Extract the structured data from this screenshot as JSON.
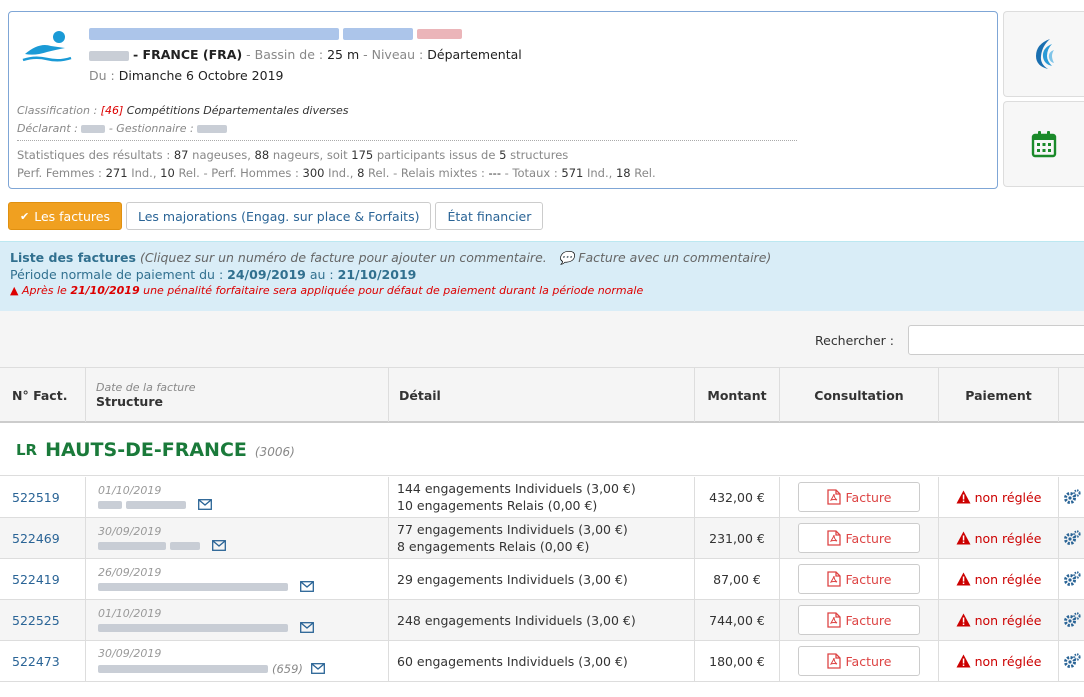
{
  "competition": {
    "date_prefix": "Du :",
    "date_value": "Dimanche 6 Octobre 2019",
    "country": "- FRANCE (FRA)",
    "bassin_label": "- Bassin de :",
    "bassin_value": "25 m",
    "niveau_label": "- Niveau :",
    "niveau_value": "Départemental",
    "classification_label": "Classification :",
    "classification_code": "[46]",
    "classification_value": "Compétitions Départementales diverses",
    "declarant_label": "Déclarant :",
    "gestionnaire_label": "- Gestionnaire :",
    "stats": {
      "prefix": "Statistiques des résultats :",
      "nageuses": "87",
      "nageuses_label": "nageuses,",
      "nageurs": "88",
      "nageurs_label": "nageurs, soit",
      "participants": "175",
      "participants_label": "participants issus de",
      "structures": "5",
      "structures_label": "structures"
    },
    "perf": {
      "femmes_label": "Perf. Femmes :",
      "femmes_ind": "271",
      "ind_label": "Ind.,",
      "femmes_rel": "10",
      "rel_label": "Rel.",
      "hommes_label": "- Perf. Hommes :",
      "hommes_ind": "300",
      "hommes_rel": "8",
      "mixtes_label": "Rel. - Relais mixtes :",
      "mixtes_value": "---",
      "totaux_label": "- Totaux :",
      "totaux_ind": "571",
      "totaux_rel": "18",
      "rel_end": "Rel."
    }
  },
  "tabs": [
    {
      "label": "Les factures"
    },
    {
      "label": "Les majorations (Engag. sur place & Forfaits)"
    },
    {
      "label": "État financier"
    }
  ],
  "info": {
    "title": "Liste des factures",
    "hint": "(Cliquez sur un numéro de facture pour ajouter un commentaire.",
    "hint2": "Facture avec un commentaire)",
    "period_prefix": "Période normale de paiement du :",
    "period_start": "24/09/2019",
    "period_mid": "au :",
    "period_end": "21/10/2019",
    "warning_prefix": "Après le",
    "warning_date": "21/10/2019",
    "warning_text": "une pénalité forfaitaire sera appliquée pour défaut de paiement durant la période normale"
  },
  "search": {
    "label": "Rechercher :",
    "placeholder": ""
  },
  "table": {
    "headers": {
      "num": "N° Fact.",
      "date": "Date de la facture",
      "structure": "Structure",
      "detail": "Détail",
      "montant": "Montant",
      "consultation": "Consultation",
      "paiement": "Paiement"
    },
    "region": {
      "badge": "LR",
      "name": "HAUTS-DE-FRANCE",
      "code": "(3006)"
    },
    "rows": [
      {
        "num": "522519",
        "date": "01/10/2019",
        "code": "",
        "detail": [
          "144 engagements Individuels (3,00 €)",
          "10 engagements Relais (0,00 €)"
        ],
        "amount": "432,00 €",
        "button": "Facture",
        "status": "non réglée"
      },
      {
        "num": "522469",
        "date": "30/09/2019",
        "code": "",
        "detail": [
          "77 engagements Individuels (3,00 €)",
          "8 engagements Relais (0,00 €)"
        ],
        "amount": "231,00 €",
        "button": "Facture",
        "status": "non réglée"
      },
      {
        "num": "522419",
        "date": "26/09/2019",
        "code": "",
        "detail": [
          "29 engagements Individuels (3,00 €)"
        ],
        "amount": "87,00 €",
        "button": "Facture",
        "status": "non réglée"
      },
      {
        "num": "522525",
        "date": "01/10/2019",
        "code": "",
        "detail": [
          "248 engagements Individuels (3,00 €)"
        ],
        "amount": "744,00 €",
        "button": "Facture",
        "status": "non réglée"
      },
      {
        "num": "522473",
        "date": "30/09/2019",
        "code": "(659)",
        "detail": [
          "60 engagements Individuels (3,00 €)"
        ],
        "amount": "180,00 €",
        "button": "Facture",
        "status": "non réglée"
      }
    ]
  },
  "colors": {
    "accent": "#f0a020",
    "link": "#2a6496",
    "region": "#1a7a3a",
    "danger": "#cc0000"
  }
}
